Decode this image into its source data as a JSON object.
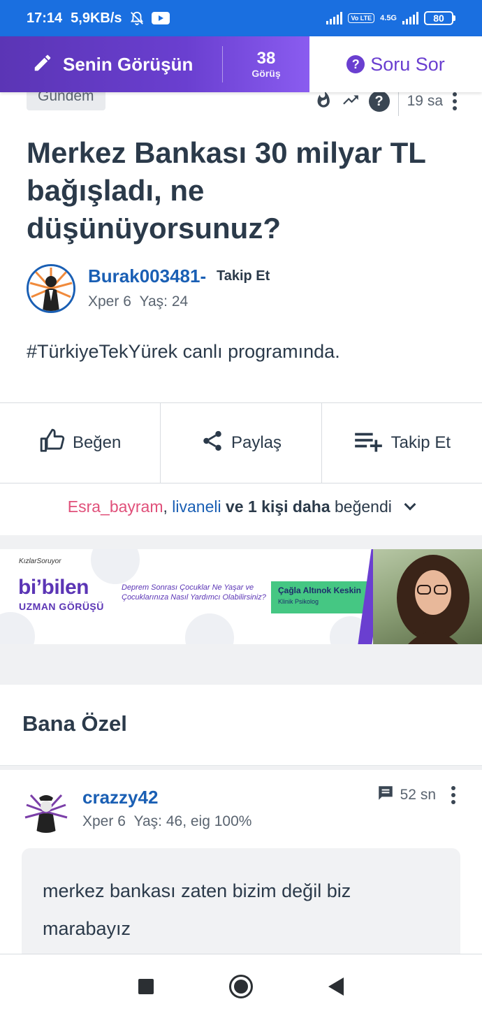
{
  "status_bar": {
    "time": "17:14",
    "speed": "5,9KB/s",
    "volte": "Vo LTE",
    "network": "4.5G",
    "battery": "80"
  },
  "top_bar": {
    "write_label": "Senin Görüşün",
    "views_count": "38",
    "views_label": "Görüş",
    "ask_label": "Soru Sor",
    "colors": {
      "accent": "#6a3fd0",
      "accent_dark": "#5b35b5"
    }
  },
  "post": {
    "category": "Gündem",
    "time_ago": "19 sa",
    "title": "Merkez Bankası 30 milyar TL bağışladı, ne düşünüyorsunuz?",
    "author": {
      "name": "Burak003481",
      "separator": "-",
      "follow_label": "Takip Et",
      "xper": "Xper 6",
      "age": "Yaş: 24"
    },
    "body": "#TürkiyeTekYürek canlı programında."
  },
  "actions": {
    "like": "Beğen",
    "share": "Paylaş",
    "follow": "Takip Et"
  },
  "likes_summary": {
    "user1": "Esra_bayram",
    "comma": ",",
    "user2": "livaneli",
    "ve": "ve",
    "count_text": "1 kişi daha",
    "suffix": "beğendi"
  },
  "banner": {
    "brand": "KızlarSoruyor",
    "big": "bi’bilen",
    "small": "UZMAN GÖRÜŞÜ",
    "description": "Deprem Sonrası Çocuklar Ne Yaşar ve Çocuklarınıza Nasıl Yardımcı Olabilirsiniz?",
    "expert_name": "Çağla Altınok Keskin",
    "expert_role": "Klinik Psikolog"
  },
  "section": {
    "title": "Bana Özel"
  },
  "answer": {
    "name": "crazzy42",
    "xper": "Xper 6",
    "details": "Yaş: 46, eig 100%",
    "time_ago": "52 sn",
    "text": "merkez bankası zaten bizim değil biz marabayız"
  }
}
